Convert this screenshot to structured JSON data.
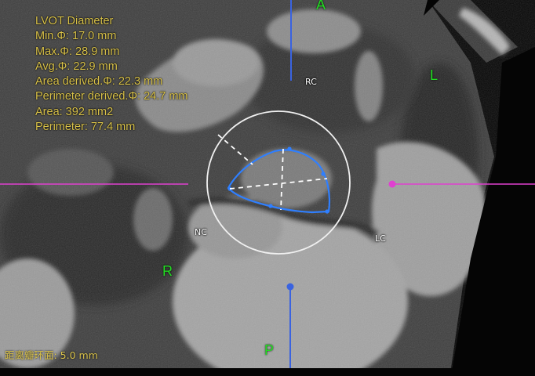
{
  "measurement": {
    "title": "LVOT Diameter",
    "min": "Min.Φ: 17.0 mm",
    "max": "Max.Φ: 28.9 mm",
    "avg": "Avg.Φ: 22.9 mm",
    "area_derived": "Area derived.Φ: 22.3 mm",
    "perimeter_derived": "Perimeter derived.Φ: 24.7 mm",
    "area": "Area: 392 mm2",
    "perimeter": "Perimeter: 77.4 mm"
  },
  "orientation": {
    "anterior": "A",
    "posterior": "P",
    "left": "L",
    "right": "R"
  },
  "cusps": {
    "rc": "RC",
    "nc": "NC",
    "lc": "LC"
  },
  "distance_label": "距离瓣环面: 5.0 mm",
  "colors": {
    "annotation_text": "#d9c24a",
    "orientation_label": "#22dd22",
    "vertical_crosshair": "#3a63e0",
    "horizontal_crosshair": "#e040d0",
    "contour": "#2f7fff",
    "ring": "#ffffff"
  }
}
